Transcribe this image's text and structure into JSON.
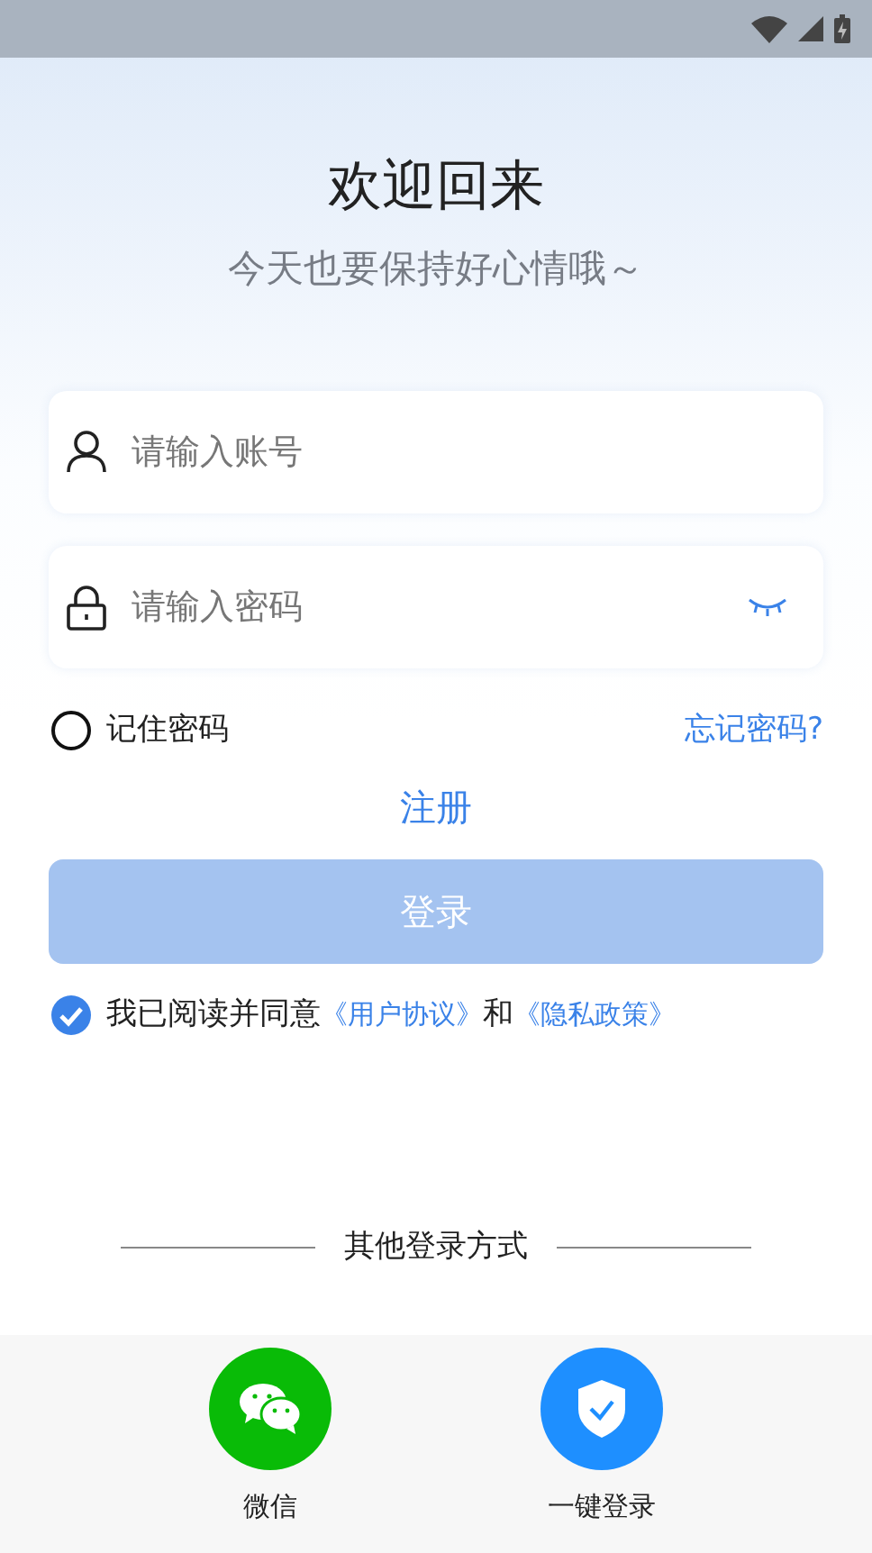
{
  "title": "欢迎回来",
  "subtitle": "今天也要保持好心情哦～",
  "account_field": {
    "placeholder": "请输入账号"
  },
  "password_field": {
    "placeholder": "请输入密码",
    "visible": false
  },
  "remember": {
    "label": "记住密码",
    "checked": false
  },
  "forgot_link": "忘记密码?",
  "register_link": "注册",
  "login_button": {
    "label": "登录",
    "disabled": true
  },
  "agreement": {
    "checked": true,
    "parts": [
      {
        "kind": "text",
        "text": "我已阅读并同意"
      },
      {
        "kind": "link",
        "text": "《用户协议》"
      },
      {
        "kind": "text",
        "text": "和"
      },
      {
        "kind": "link",
        "text": "《隐私政策》"
      }
    ]
  },
  "other_login": {
    "label": "其他登录方式",
    "options": [
      {
        "kind": "wechat",
        "label": "微信"
      },
      {
        "kind": "one_tap",
        "label": "一键登录"
      }
    ]
  }
}
